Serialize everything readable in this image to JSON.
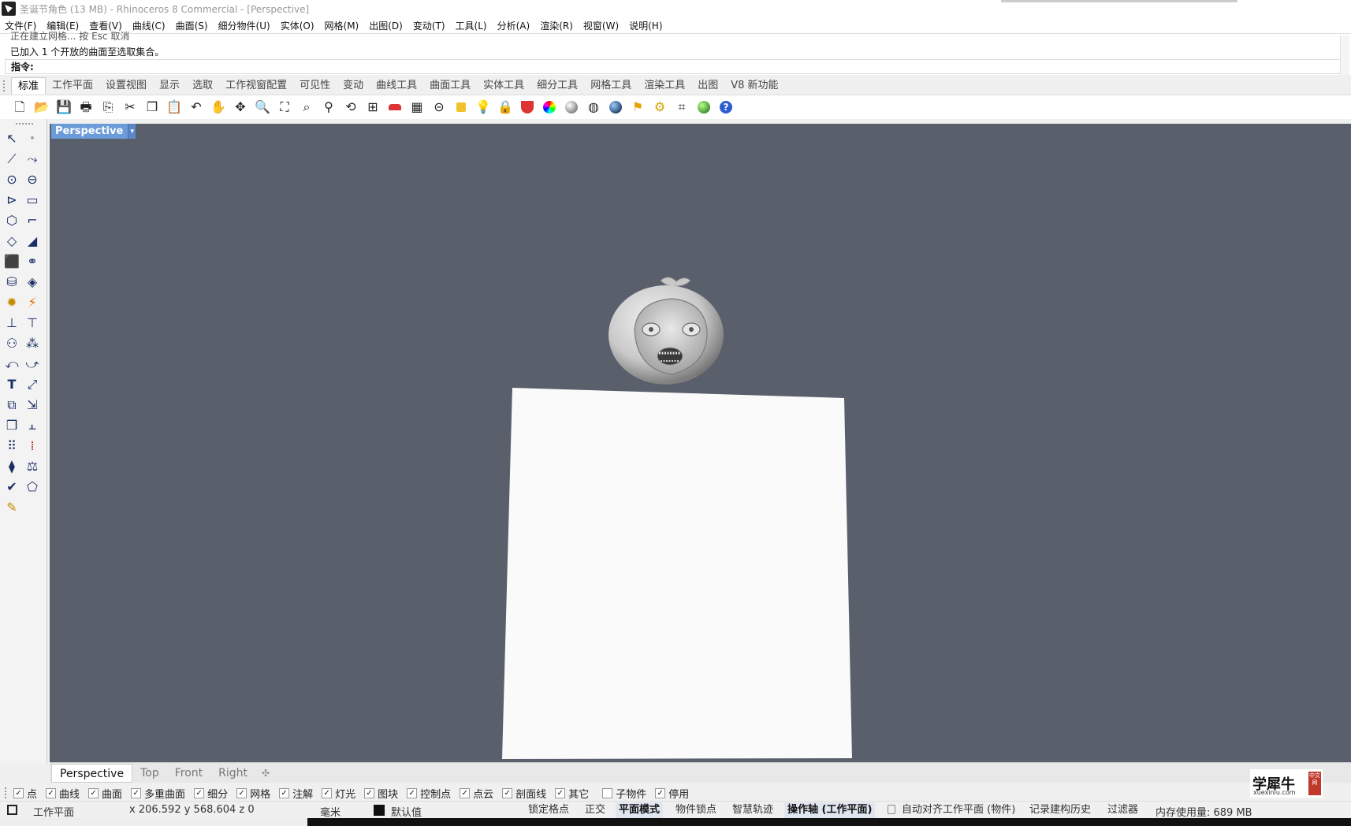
{
  "window": {
    "title": "圣诞节角色 (13 MB) - Rhinoceros 8 Commercial - [Perspective]"
  },
  "menu": [
    "文件(F)",
    "编辑(E)",
    "查看(V)",
    "曲线(C)",
    "曲面(S)",
    "细分物件(U)",
    "实体(O)",
    "网格(M)",
    "出图(D)",
    "变动(T)",
    "工具(L)",
    "分析(A)",
    "渲染(R)",
    "视窗(W)",
    "说明(H)"
  ],
  "command": {
    "cut_line": "正在建立网格... 按 Esc 取消",
    "history": "已加入 1 个开放的曲面至选取集合。",
    "prompt": "指令:",
    "input_value": ""
  },
  "toolbar_tabs": [
    "标准",
    "工作平面",
    "设置视图",
    "显示",
    "选取",
    "工作视窗配置",
    "可见性",
    "变动",
    "曲线工具",
    "曲面工具",
    "实体工具",
    "细分工具",
    "网格工具",
    "渲染工具",
    "出图",
    "V8 新功能"
  ],
  "toolbar_icons": [
    "new-icon",
    "open-icon",
    "save-icon",
    "print-icon",
    "export-icon",
    "cut-icon",
    "copy-icon",
    "paste-icon",
    "undo-icon",
    "pan-icon",
    "rotate-view-icon",
    "zoom-dynamic-icon",
    "zoom-window-icon",
    "zoom-extents-icon",
    "zoom-selected-icon",
    "undo-view-icon",
    "four-viewports-icon",
    "car-icon",
    "layout-icon",
    "cplane-icon",
    "object-properties-icon",
    "light-icon",
    "lock-icon",
    "layer-icon",
    "color-wheel-icon",
    "shade-icon",
    "wireframe-sphere-icon",
    "render-sphere-icon",
    "pointer-flag-icon",
    "options-gear-icon",
    "snap-grid-icon",
    "globe-icon",
    "help-icon"
  ],
  "viewport": {
    "active_name": "Perspective",
    "tabs": [
      "Perspective",
      "Top",
      "Front",
      "Right"
    ],
    "add_tab": "✣",
    "background": "#595f6b"
  },
  "osnaps": [
    {
      "label": "点",
      "checked": true
    },
    {
      "label": "曲线",
      "checked": true
    },
    {
      "label": "曲面",
      "checked": true
    },
    {
      "label": "多重曲面",
      "checked": true
    },
    {
      "label": "细分",
      "checked": true
    },
    {
      "label": "网格",
      "checked": true
    },
    {
      "label": "注解",
      "checked": true
    },
    {
      "label": "灯光",
      "checked": true
    },
    {
      "label": "图块",
      "checked": true
    },
    {
      "label": "控制点",
      "checked": true
    },
    {
      "label": "点云",
      "checked": true
    },
    {
      "label": "剖面线",
      "checked": true
    },
    {
      "label": "其它",
      "checked": true
    },
    {
      "label": "子物件",
      "checked": false
    },
    {
      "label": "停用",
      "checked": true
    }
  ],
  "status": {
    "cplane": "工作平面",
    "coords": "x 206.592   y 568.604   z 0",
    "units": "毫米",
    "layer": "默认值",
    "grid_snap": "锁定格点",
    "ortho": "正交",
    "planar": "平面模式",
    "osnap": "物件锁点",
    "smart_track": "智慧轨迹",
    "gumball": "操作轴 (工作平面)",
    "auto_cplane": "自动对齐工作平面 (物件)",
    "history": "记录建构历史",
    "filter": "过滤器",
    "memory": "内存使用量: 689 MB"
  },
  "watermark": {
    "title": "学犀牛",
    "url": "xuexiniu.com",
    "stamp": "中文网"
  }
}
